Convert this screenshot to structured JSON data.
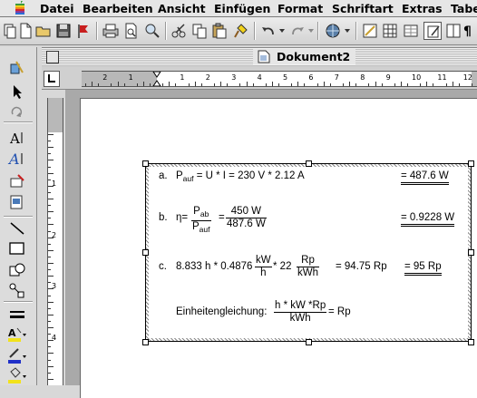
{
  "menu": {
    "items": [
      "Datei",
      "Bearbeiten",
      "Ansicht",
      "Einfügen",
      "Format",
      "Schriftart",
      "Extras",
      "Tabelle"
    ]
  },
  "toolbar": {
    "icons": [
      "stack-icon",
      "new-document-icon",
      "open-folder-icon",
      "save-icon",
      "flag-icon",
      "print-icon",
      "print-preview-icon",
      "spelling-icon",
      "cut-icon",
      "copy-icon",
      "paste-icon",
      "format-painter-icon",
      "undo-icon",
      "redo-icon",
      "web-toolbar-icon",
      "insert-hyperlink-icon",
      "tables-borders-icon",
      "insert-table-icon",
      "columns-icon",
      "drawing-icon",
      "paragraph-marks-icon"
    ]
  },
  "window": {
    "title": "Dokument2"
  },
  "ruler": {
    "numbers": [
      "2",
      "1",
      "1",
      "2",
      "3",
      "4",
      "5",
      "6",
      "7",
      "8",
      "9",
      "10",
      "11",
      "12",
      "13"
    ],
    "vnumbers": [
      "1",
      "2",
      "3",
      "4"
    ]
  },
  "formulas": {
    "a_label": "a.",
    "a_P": "P",
    "a_sub": "auf",
    "a_expr": " = U * I = 230 V * 2.12 A",
    "a_result": "= 487.6 W",
    "b_label": "b.",
    "b_eta": "η=",
    "b_num_P": "P",
    "b_num_sub": "ab",
    "b_den_P": "P",
    "b_den_sub": "auf",
    "b_eq": "=",
    "b_num_val": "450 W",
    "b_den_val": "487.6 W",
    "b_result": "= 0.9228 W",
    "c_label": "c.",
    "c_start": "8.833 h * 0.4876",
    "c_frac1_num": "kW",
    "c_frac1_den": "h",
    "c_mid": "* 22",
    "c_frac2_num": "Rp",
    "c_frac2_den": "kWh",
    "c_eq": "= 94.75 Rp",
    "c_result": "= 95 Rp",
    "d_text": "Einheitengleichung:",
    "d_num": "h * kW *Rp",
    "d_den": "kWh",
    "d_result": "=  Rp"
  },
  "colors": {
    "menubar": "#e6e6e6",
    "page": "#ffffff",
    "workspace": "#a9a9a9"
  }
}
